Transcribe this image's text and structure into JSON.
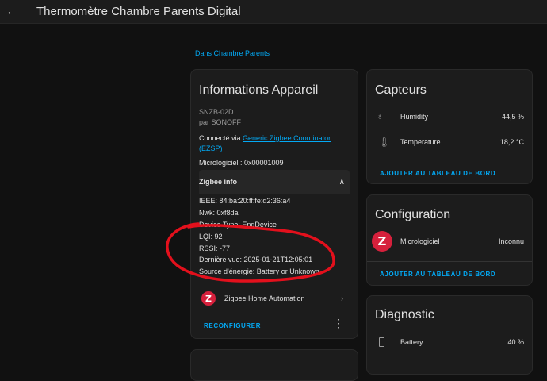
{
  "header": {
    "title": "Thermomètre Chambre Parents Digital",
    "back_icon": "arrow-left-icon"
  },
  "area_link": "Dans Chambre Parents",
  "device_info": {
    "title": "Informations Appareil",
    "model": "SNZB-02D",
    "manufacturer": "par SONOFF",
    "connected_prefix": "Connecté via ",
    "connected_link": "Generic Zigbee Coordinator (EZSP)",
    "firmware": "Micrologiciel : 0x00001009",
    "zigbee_info_title": "Zigbee info",
    "zigbee_lines": [
      "IEEE: 84:ba:20:ff:fe:d2:36:a4",
      "Nwk: 0xf8da",
      "Device Type: EndDevice",
      "LQI: 92",
      "RSSI: -77",
      "Dernière vue: 2025-01-21T12:05:01",
      "Source d'énergie: Battery or Unknown"
    ],
    "integration": "Zigbee Home Automation",
    "reconfigure": "RECONFIGURER",
    "annotation_color": "#e3101c"
  },
  "sensors": {
    "title": "Capteurs",
    "rows": [
      {
        "icon": "water-drop-icon",
        "label": "Humidity",
        "value": "44,5 %"
      },
      {
        "icon": "thermometer-icon",
        "label": "Temperature",
        "value": "18,2 °C"
      }
    ],
    "add_to_dashboard": "AJOUTER AU TABLEAU DE BORD"
  },
  "configuration": {
    "title": "Configuration",
    "row": {
      "icon": "zigbee-icon",
      "label": "Micrologiciel",
      "value": "Inconnu"
    },
    "add_to_dashboard": "AJOUTER AU TABLEAU DE BORD"
  },
  "diagnostic": {
    "title": "Diagnostic",
    "row": {
      "icon": "battery-icon",
      "label": "Battery",
      "value": "40 %"
    }
  },
  "colors": {
    "accent": "#03a9f4",
    "background": "#111111",
    "card": "#1c1c1c",
    "zigbee_red": "#d6203c"
  }
}
